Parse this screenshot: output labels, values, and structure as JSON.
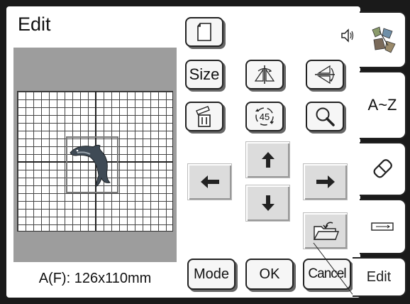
{
  "title": "Edit",
  "size_label": "A(F): 126x110mm",
  "buttons": {
    "size": "Size",
    "rotate_45": "45",
    "mode": "Mode",
    "ok": "OK",
    "cancel": "Cancel"
  },
  "side_tabs": {
    "alphabet": "A~Z",
    "edit": "Edit"
  },
  "icons": [
    "speaker-icon",
    "new-page-icon",
    "flip-horizontal-icon",
    "flip-vertical-icon",
    "delete-icon",
    "rotate-icon",
    "zoom-icon",
    "arrow-up-icon",
    "arrow-left-icon",
    "arrow-right-icon",
    "arrow-down-icon",
    "open-folder-icon",
    "embroidery-pattern-icon",
    "eraser-icon",
    "usb-icon",
    "dolphin-icon"
  ],
  "colors": {
    "frame": "#1a1a1a",
    "preview_bg": "#9d9d9d",
    "button_bg": "#f6f6f6"
  }
}
